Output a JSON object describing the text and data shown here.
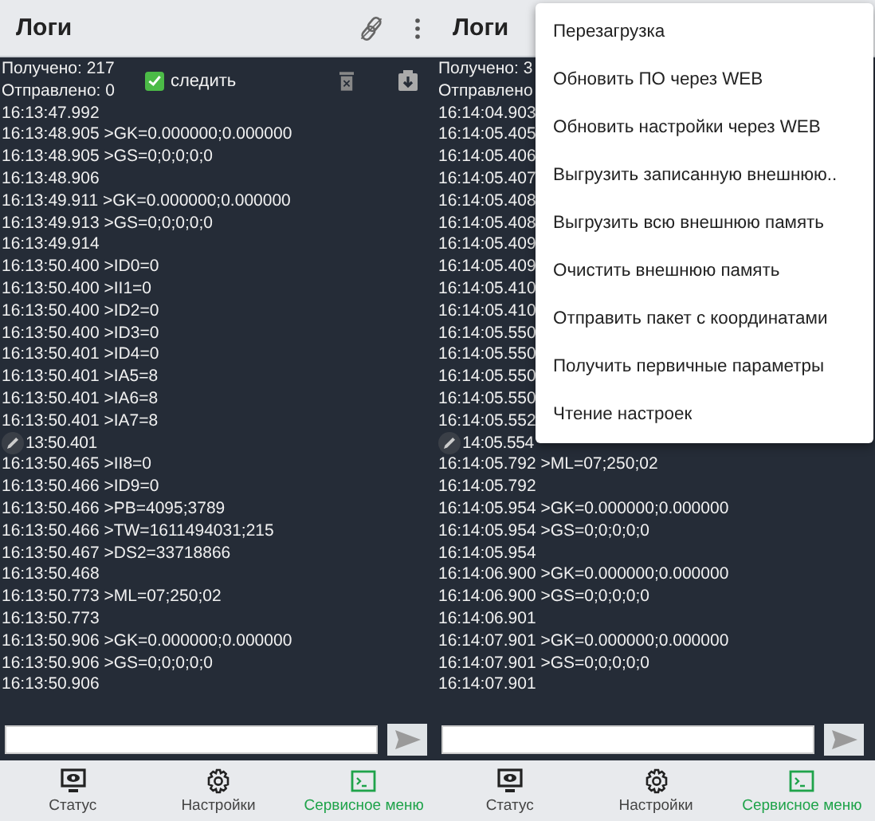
{
  "panes": [
    {
      "title": "Логи",
      "received": "Получено: 217",
      "sent": "Отправлено: 0",
      "follow": {
        "label": "следить",
        "checked": true
      },
      "lines": [
        "16:13:47.992",
        "16:13:48.905 >GK=0.000000;0.000000",
        "16:13:48.905 >GS=0;0;0;0;0",
        "16:13:48.906",
        "16:13:49.911 >GK=0.000000;0.000000",
        "16:13:49.913 >GS=0;0;0;0;0",
        "16:13:49.914",
        "16:13:50.400 >ID0=0",
        "16:13:50.400 >II1=0",
        "16:13:50.400 >ID2=0",
        "16:13:50.400 >ID3=0",
        "16:13:50.401 >ID4=0",
        "16:13:50.401 >IA5=8",
        "16:13:50.401 >IA6=8",
        "16:13:50.401 >IA7=8",
        {
          "kind": "fab",
          "text": "13:50.401"
        },
        "16:13:50.465 >II8=0",
        "16:13:50.466 >ID9=0",
        "16:13:50.466 >PB=4095;3789",
        "16:13:50.466 >TW=1611494031;215",
        "16:13:50.467 >DS2=33718866",
        "16:13:50.468",
        "16:13:50.773 >ML=07;250;02",
        "16:13:50.773",
        "16:13:50.906 >GK=0.000000;0.000000",
        "16:13:50.906 >GS=0;0;0;0;0",
        "16:13:50.906"
      ],
      "nav": [
        {
          "label": "Статус",
          "selected": false
        },
        {
          "label": "Настройки",
          "selected": false
        },
        {
          "label": "Сервисное меню",
          "selected": true
        }
      ]
    },
    {
      "title": "Логи",
      "received": "Получено: 3",
      "sent": "Отправлено",
      "lines": [
        "16:14:04.903",
        "16:14:05.405",
        "16:14:05.406",
        "16:14:05.407",
        "16:14:05.408",
        "16:14:05.408",
        "16:14:05.409",
        "16:14:05.409",
        "16:14:05.410",
        "16:14:05.410",
        "16:14:05.550",
        "16:14:05.550",
        "16:14:05.550",
        "16:14:05.550",
        "16:14:05.552",
        {
          "kind": "fab",
          "text": "14:05.554"
        },
        "16:14:05.792 >ML=07;250;02",
        "16:14:05.792",
        "16:14:05.954 >GK=0.000000;0.000000",
        "16:14:05.954 >GS=0;0;0;0;0",
        "16:14:05.954",
        "16:14:06.900 >GK=0.000000;0.000000",
        "16:14:06.900 >GS=0;0;0;0;0",
        "16:14:06.901",
        "16:14:07.901 >GK=0.000000;0.000000",
        "16:14:07.901 >GS=0;0;0;0;0",
        "16:14:07.901"
      ],
      "nav": [
        {
          "label": "Статус",
          "selected": false
        },
        {
          "label": "Настройки",
          "selected": false
        },
        {
          "label": "Сервисное меню",
          "selected": true
        }
      ],
      "menu": [
        "Перезагрузка",
        "Обновить ПО через WEB",
        "Обновить настройки через WEB",
        "Выгрузить записанную внешнюю..",
        "Выгрузить всю внешнюю память",
        "Очистить внешнюю память",
        "Отправить пакет с координатами",
        "Получить первичные параметры",
        "Чтение настроек"
      ]
    }
  ]
}
